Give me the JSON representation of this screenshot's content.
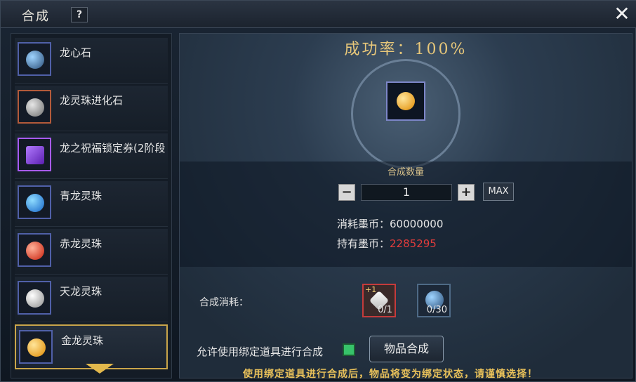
{
  "window": {
    "title": "合成",
    "help": "?",
    "close": "✕"
  },
  "items": [
    {
      "label": "龙心石",
      "icon": "dragon-heart-stone-icon",
      "color": "#4a78a8"
    },
    {
      "label": "龙灵珠进化石",
      "icon": "dragon-pearl-evolution-stone-icon",
      "color": "#b35a3a"
    },
    {
      "label": "龙之祝福锁定券(2阶段",
      "icon": "blessing-lock-ticket-icon",
      "color": "#7a35c8"
    },
    {
      "label": "青龙灵珠",
      "icon": "azure-pearl-icon",
      "color": "#3aa8ff"
    },
    {
      "label": "赤龙灵珠",
      "icon": "red-pearl-icon",
      "color": "#ff4a2a"
    },
    {
      "label": "天龙灵珠",
      "icon": "white-pearl-icon",
      "color": "#d9d9d9"
    },
    {
      "label": "金龙灵珠",
      "icon": "gold-pearl-icon",
      "color": "#f2b418"
    }
  ],
  "selected_index": 6,
  "synthesis": {
    "rate_text": "成功率：100%",
    "qty_title": "合成数量",
    "qty_value": "1",
    "minus": "−",
    "plus": "+",
    "max_label": "MAX",
    "cost_label": "消耗墨币：",
    "cost_value": "60000000",
    "own_label": "持有墨币：",
    "own_value": "2285295",
    "consume_label": "合成消耗：",
    "materials": [
      {
        "icon": "crystal-fragment-icon",
        "count": "0/1",
        "plus": "+1"
      },
      {
        "icon": "dragon-heart-stone-icon",
        "count": "0/30"
      }
    ],
    "bind_label": "允许使用绑定道具进行合成",
    "button_label": "物品合成",
    "warning": "使用绑定道具进行合成后，物品将变为绑定状态，请谨慎选择！"
  }
}
